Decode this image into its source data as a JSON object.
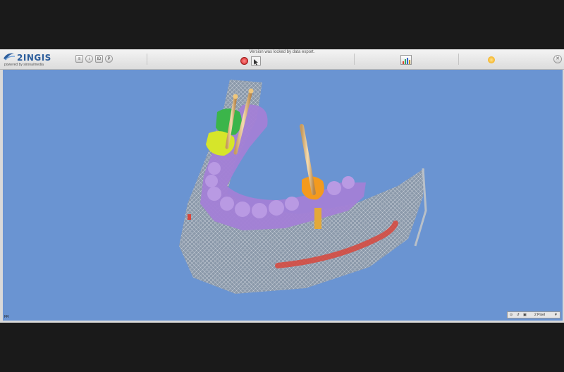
{
  "app": {
    "logo_text": "2INGIS",
    "logo_subtext": "powered by sirona/media",
    "status_message": "Version was locked by data export."
  },
  "toolbar": {
    "left_icons": [
      "list-icon",
      "info-icon",
      "id-icon",
      "group-icon"
    ],
    "left_labels": [
      "",
      "i",
      "ID",
      "P"
    ],
    "center_icons": [
      "record-icon",
      "pointer-icon"
    ],
    "right_icons": [
      "panorama-chart-icon",
      "sun-icon",
      "close-icon"
    ]
  },
  "viewport": {
    "background": "#6a94d2",
    "corner_label": "FR",
    "view_control": {
      "icons": "⊙ ↺ ▣",
      "selected": "2 Pixel",
      "caret": "▼"
    }
  },
  "scene": {
    "bone_color": "#9aa3ad",
    "guide_color": "#a37fd6",
    "implant_pin_color": "#e8c48a",
    "crown_orange": "#f39a1e",
    "crown_green": "#3bb54a",
    "crown_yellow": "#d6e52a",
    "nerve_color": "#d8463c"
  }
}
